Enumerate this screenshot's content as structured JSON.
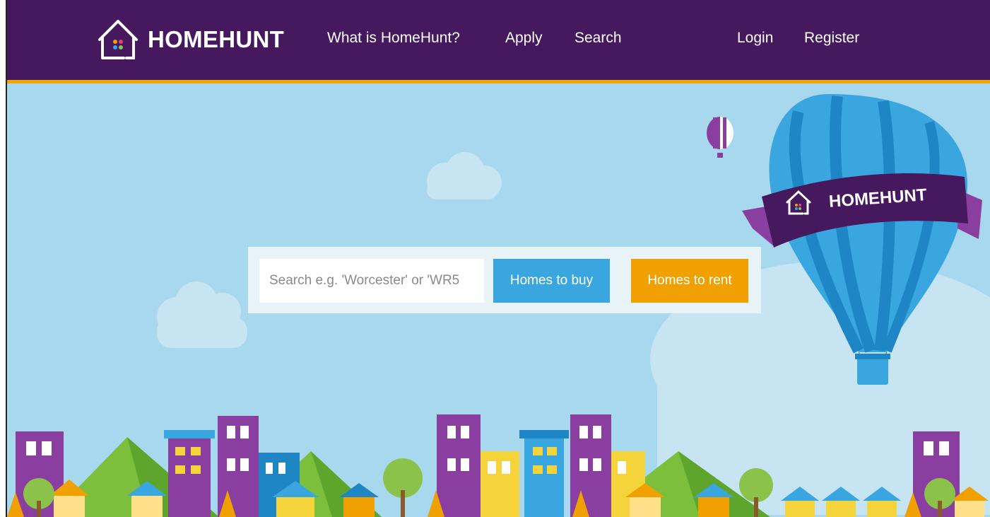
{
  "brand": {
    "name": "HOMEHUNT",
    "banner_text": "HOMEHUNT"
  },
  "nav": {
    "items": [
      "What is HomeHunt?",
      "Apply",
      "Search"
    ],
    "account": [
      "Login",
      "Register"
    ]
  },
  "search": {
    "placeholder": "Search e.g. 'Worcester' or 'WR5",
    "buy_label": "Homes to buy",
    "rent_label": "Homes to rent"
  },
  "colors": {
    "header": "#46195e",
    "accent_stripe": "#f0a500",
    "sky": "#a8d8ee",
    "buy_button": "#3aa6df",
    "rent_button": "#f0a000"
  }
}
